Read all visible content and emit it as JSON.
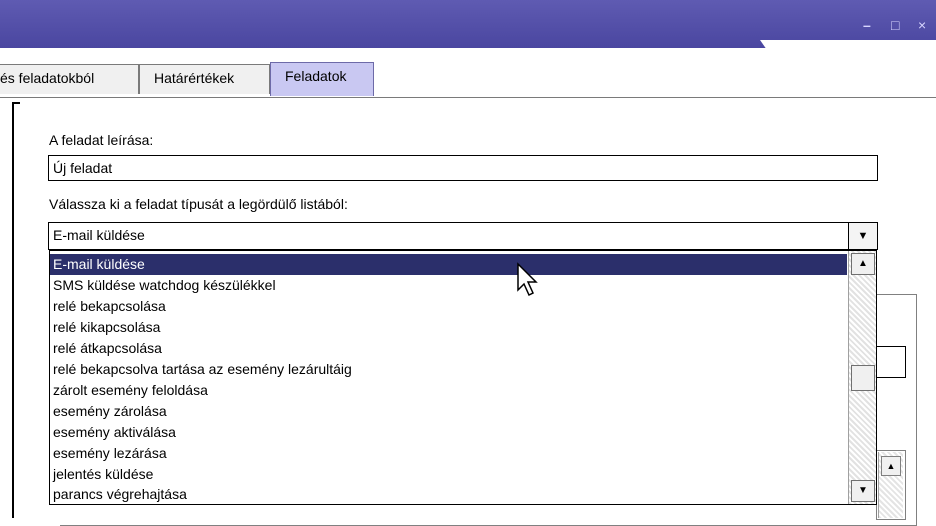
{
  "window": {
    "minimize_glyph": "–",
    "maximize_glyph": "□",
    "close_glyph": "×"
  },
  "tabs": [
    {
      "label": "és feladatokból"
    },
    {
      "label": "Határértékek"
    },
    {
      "label": "Feladatok"
    }
  ],
  "form": {
    "description_label": "A feladat leírása:",
    "description_value": "Új feladat",
    "type_label": "Válassza ki a feladat típusát a legördülő listából:",
    "type_value": "E-mail küldése"
  },
  "dropdown": {
    "options": [
      "E-mail küldése",
      "SMS küldése watchdog készülékkel",
      "relé bekapcsolása",
      "relé kikapcsolása",
      "relé átkapcsolása",
      "relé bekapcsolva tartása az esemény lezárultáig",
      "zárolt esemény feloldása",
      "esemény zárolása",
      "esemény aktiválása",
      "esemény lezárása",
      "jelentés küldése",
      "parancs végrehajtása"
    ],
    "selected_index": 0
  },
  "colors": {
    "titlebar": "#4a46a0",
    "active_tab": "#c9c8f2",
    "selection": "#2b2f6b"
  }
}
